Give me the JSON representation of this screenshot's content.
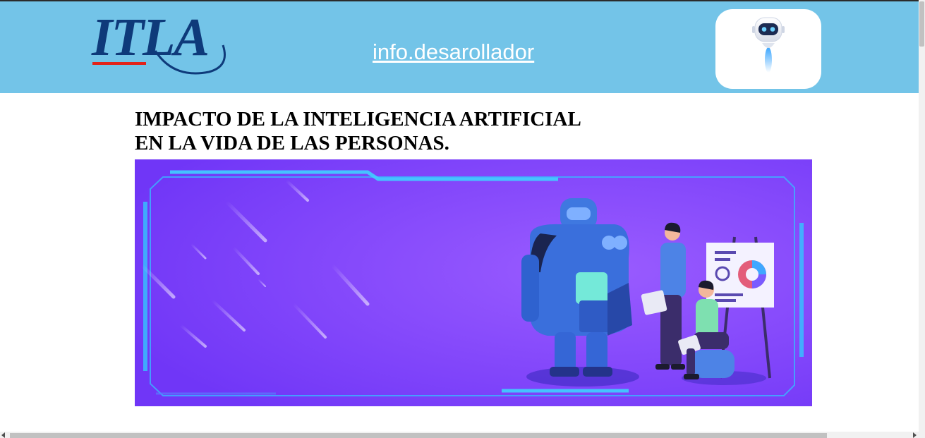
{
  "header": {
    "logo_text": "ITLA",
    "link_text": "info.desarollador",
    "bot_icon": "robot-mascot-icon",
    "background_color": "#73c4e8"
  },
  "article": {
    "title_line1": "IMPACTO DE LA INTELIGENCIA ARTIFICIAL",
    "title_line2": "EN LA VIDA DE LAS PERSONAS."
  },
  "banner": {
    "illustration": "ai-robot-and-people-illustration",
    "background_color": "#7b3dfa"
  },
  "colors": {
    "logo_blue": "#0e3a7a",
    "logo_red": "#e2231a"
  }
}
